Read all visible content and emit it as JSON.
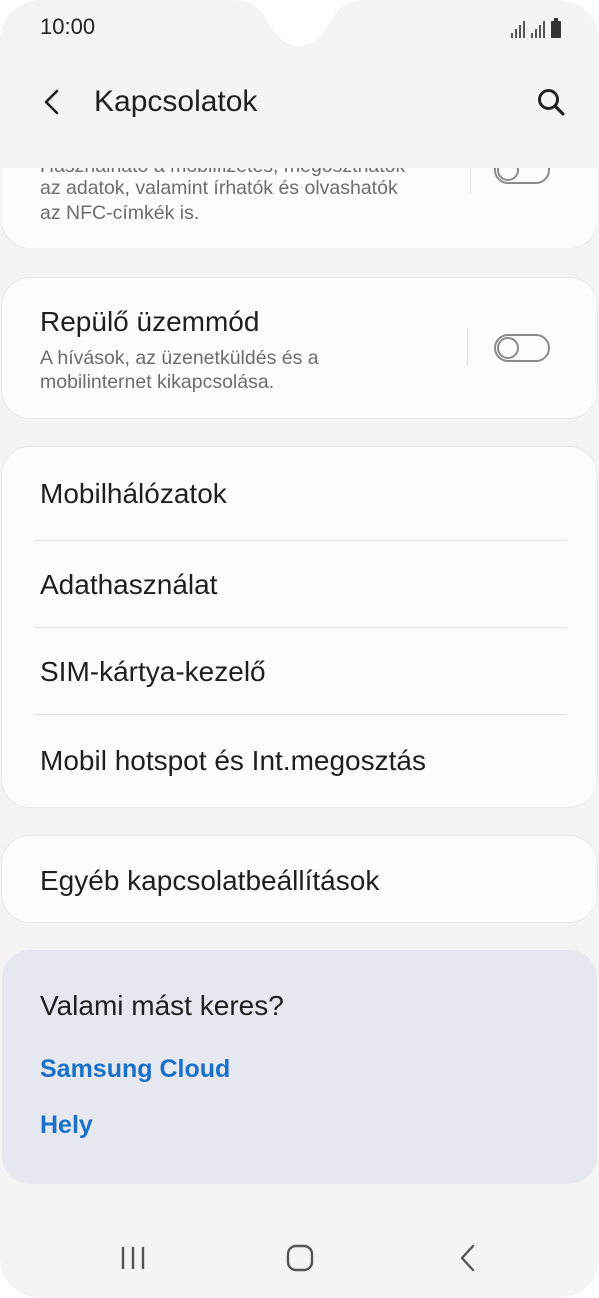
{
  "status_bar": {
    "time": "10:00"
  },
  "header": {
    "title": "Kapcsolatok",
    "back_icon": "chevron-left-icon",
    "search_icon": "search-icon"
  },
  "nfc_card": {
    "desc_line_1": "Használható a mobilfizetés, megoszthatók",
    "desc_line_2": "az adatok, valamint írhatók és olvashatók",
    "desc_line_3": "az NFC-címkék is.",
    "toggle_on": false
  },
  "airplane_card": {
    "title": "Repülő üzemmód",
    "desc_line_1": "A hívások, az üzenetküldés és a",
    "desc_line_2": "mobilinternet kikapcsolása.",
    "toggle_on": false
  },
  "network_menu": {
    "items": [
      {
        "label": "Mobilhálózatok"
      },
      {
        "label": "Adathasználat"
      },
      {
        "label": "SIM-kártya-kezelő"
      },
      {
        "label": "Mobil hotspot és Int.megosztás"
      }
    ]
  },
  "other_menu": {
    "label": "Egyéb kapcsolatbeállítások"
  },
  "suggestions": {
    "title": "Valami mást keres?",
    "links": [
      "Samsung Cloud",
      "Hely"
    ],
    "link_color": "#1a6fc9"
  },
  "nav_bar": {
    "recents_icon": "recents-icon",
    "home_icon": "home-icon",
    "back_icon": "back-icon"
  }
}
